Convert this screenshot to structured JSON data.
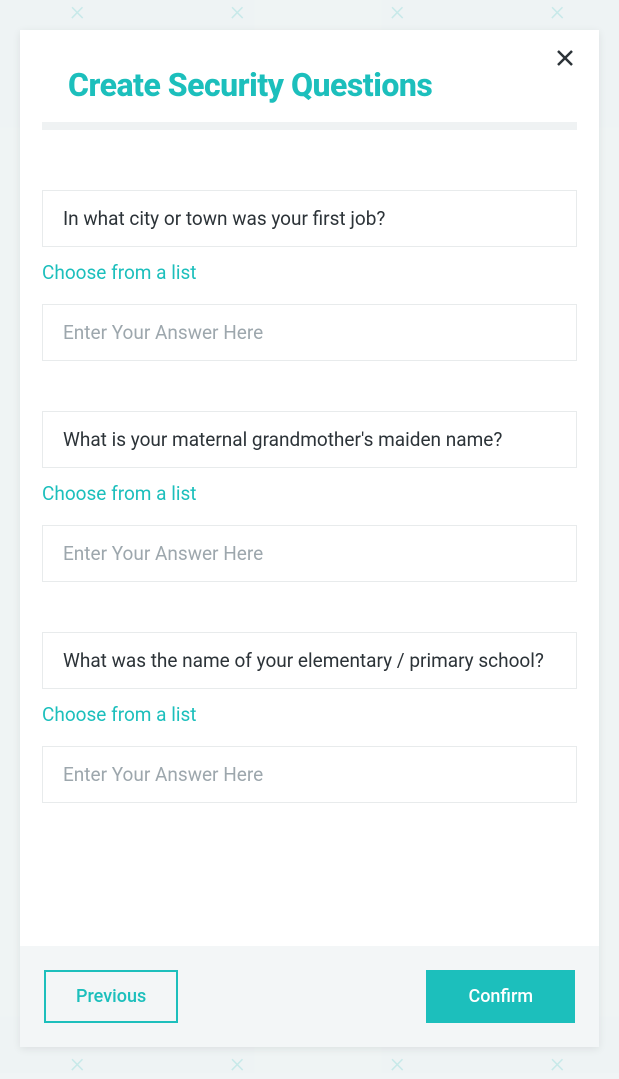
{
  "header": {
    "title": "Create Security Questions"
  },
  "questions": [
    {
      "question_value": "In what city or town was your first job?",
      "choose_link": "Choose from a list",
      "answer_placeholder": "Enter Your Answer Here"
    },
    {
      "question_value": "What is your maternal grandmother's maiden name?",
      "choose_link": "Choose from a list",
      "answer_placeholder": "Enter Your Answer Here"
    },
    {
      "question_value": "What was the name of your elementary / primary school?",
      "choose_link": "Choose from a list",
      "answer_placeholder": "Enter Your Answer Here"
    }
  ],
  "footer": {
    "previous_label": "Previous",
    "confirm_label": "Confirm"
  }
}
